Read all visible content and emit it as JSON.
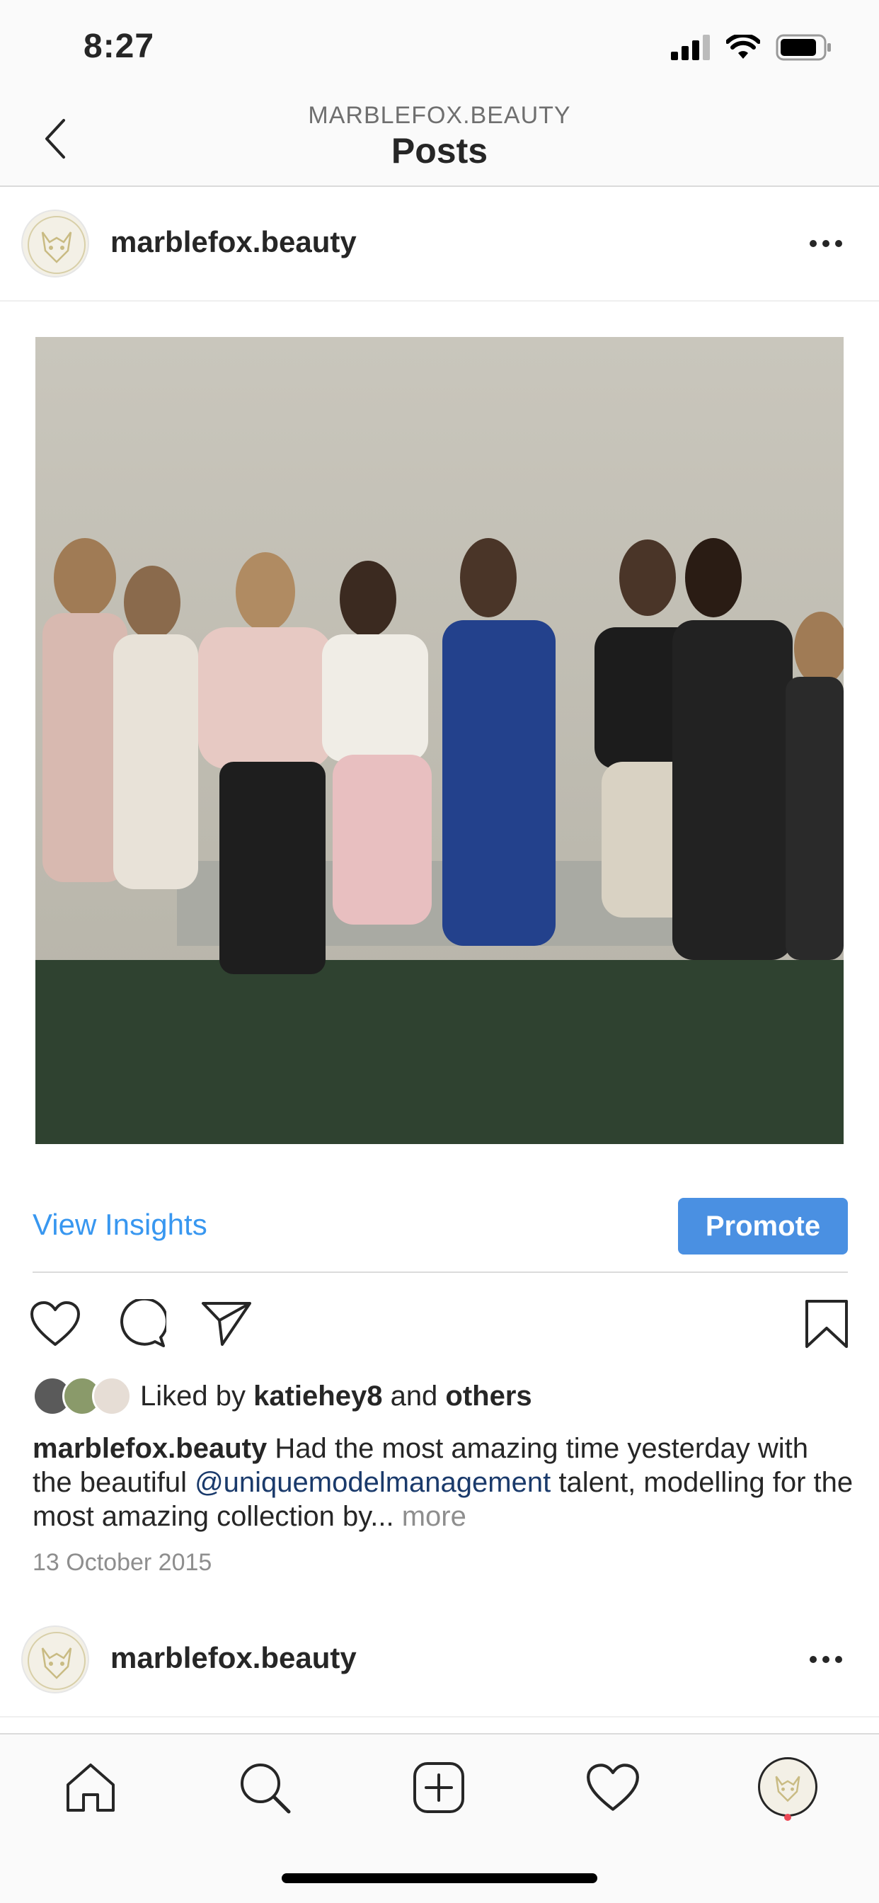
{
  "status_bar": {
    "time": "8:27"
  },
  "nav": {
    "subtitle": "MARBLEFOX.BEAUTY",
    "title": "Posts"
  },
  "post": {
    "username": "marblefox.beauty",
    "insights_label": "View Insights",
    "promote_label": "Promote",
    "likes": {
      "prefix": "Liked by ",
      "user": "katiehey8",
      "middle": " and ",
      "others": "others"
    },
    "caption": {
      "author": "marblefox.beauty",
      "text_before": " Had the most amazing time yesterday with the beautiful ",
      "mention": "@uniquemodelmanagement",
      "text_after": " talent, modelling for the most amazing collection by... ",
      "more": "more"
    },
    "date": "13 October 2015"
  },
  "next_post": {
    "username": "marblefox.beauty"
  },
  "tabbar": {
    "items": [
      "home-icon",
      "search-icon",
      "add-post-icon",
      "activity-heart-icon",
      "profile-avatar"
    ]
  },
  "colors": {
    "link": "#3897f0",
    "promote": "#4a90e2",
    "mention": "#1a3a6b",
    "notification": "#ed4956"
  }
}
